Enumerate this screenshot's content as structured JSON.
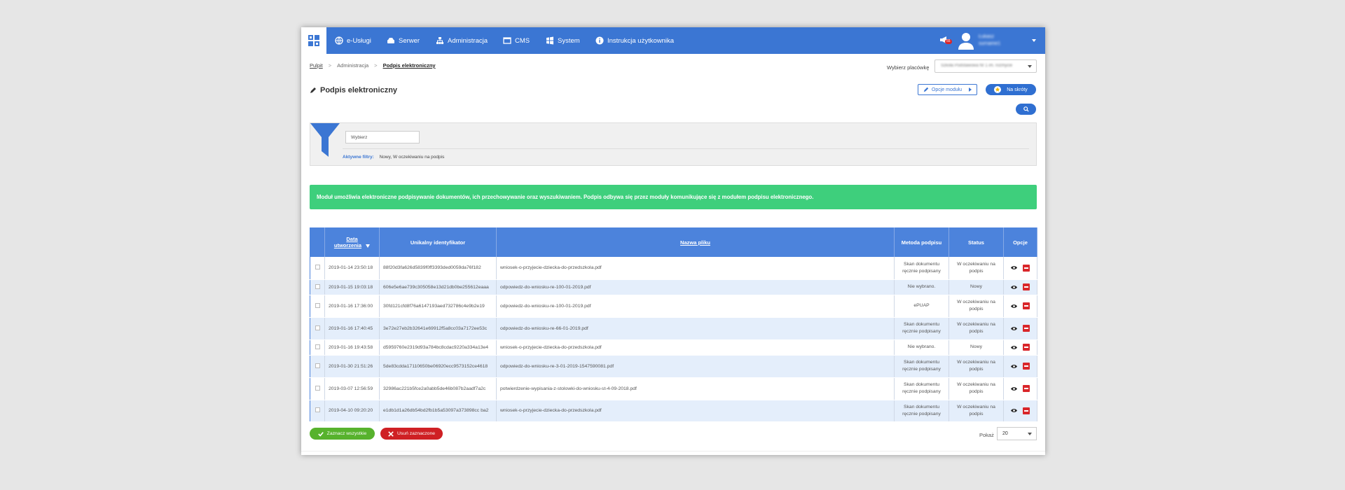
{
  "nav": {
    "items": [
      {
        "label": "e-Usługi",
        "icon": "globe-icon"
      },
      {
        "label": "Serwer",
        "icon": "server-icon"
      },
      {
        "label": "Administracja",
        "icon": "sitemap-icon"
      },
      {
        "label": "CMS",
        "icon": "cms-icon"
      },
      {
        "label": "System",
        "icon": "windows-icon"
      },
      {
        "label": "Instrukcja użytkownika",
        "icon": "info-icon"
      }
    ],
    "notification_badge": "55",
    "user_name_line1": "Łukasz",
    "user_name_line2": "surname1"
  },
  "breadcrumb": {
    "items": [
      "Pulpit",
      "Administracja",
      "Podpis elektroniczny"
    ]
  },
  "placowka": {
    "label": "Wybierz placówkę",
    "value": "Szkoła Podstawowa Nr 1 im. rozmycie"
  },
  "page": {
    "title": "Podpis elektroniczny",
    "options_button": "Opcje modułu",
    "shortcut_button": "Na skróty"
  },
  "filter": {
    "placeholder": "Wybierz",
    "active_label": "Aktywne filtry:",
    "active_value": "Nowy, W oczekiwaniu na podpis"
  },
  "alert": {
    "text": "Moduł umożliwia elektroniczne podpisywanie dokumentów, ich przechowywanie oraz wyszukiwaniem. Podpis odbywa się przez moduły komunikujące się z modułem podpisu elektronicznego."
  },
  "table": {
    "headers": {
      "date_line1": "Data",
      "date_line2": "utworzenia",
      "uid": "Unikalny identyfikator",
      "filename": "Nazwa pliku",
      "method": "Metoda podpisu",
      "status": "Status",
      "options": "Opcje"
    },
    "rows": [
      {
        "date": "2019-01-14 23:50:18",
        "uid": "88f20d3fa626d5839f0ff3393ded0059da76f182",
        "file": "wniosek-o-przyjecie-dziecka-do-przedszkola.pdf",
        "method1": "Skan dokumentu",
        "method2": "ręcznie podpisany",
        "status1": "W oczekiwaniu na",
        "status2": "podpis"
      },
      {
        "date": "2019-01-15 19:03:18",
        "uid": "606e5e6ae739c305058e13d21db0be255612eaaa",
        "file": "odpowiedz-do-wniosku-re-100-01-2019.pdf",
        "method1": "Nie wybrano.",
        "method2": "",
        "status1": "Nowy",
        "status2": ""
      },
      {
        "date": "2019-01-16 17:36:00",
        "uid": "30fd121cfd8f76a6147193aed732786c4e9b2e19",
        "file": "odpowiedz-do-wniosku-re-100-01-2019.pdf",
        "method1": "ePUAP",
        "method2": "",
        "status1": "W oczekiwaniu na",
        "status2": "podpis"
      },
      {
        "date": "2019-01-16 17:40:45",
        "uid": "3e72e27eb2b32641e69912f5a8cc03a7172ee53c",
        "file": "odpowiedz-do-wniosku-re-66-01-2019.pdf",
        "method1": "Skan dokumentu",
        "method2": "ręcznie podpisany",
        "status1": "W oczekiwaniu na",
        "status2": "podpis"
      },
      {
        "date": "2019-01-16 19:43:58",
        "uid": "d5959760e2319d93a784bc8cdac9220a334a13e4",
        "file": "wniosek-o-przyjecie-dziecka-do-przedszkola.pdf",
        "method1": "Nie wybrano.",
        "method2": "",
        "status1": "Nowy",
        "status2": ""
      },
      {
        "date": "2019-01-30 21:51:26",
        "uid": "5de83cdda17110650be06920ecc9573152ce4618",
        "file": "odpowiedz-do-wniosku-re-3-01-2019-1547590081.pdf",
        "method1": "Skan dokumentu",
        "method2": "ręcznie podpisany",
        "status1": "W oczekiwaniu na",
        "status2": "podpis"
      },
      {
        "date": "2019-03-07 12:56:59",
        "uid": "32986ac221b5fce2a0abb5de46b087b2aadf7a2c",
        "file": "potwierdzenie-wypisania-z-stolowki-do-wniosku-st-4-09-2018.pdf",
        "method1": "Skan dokumentu",
        "method2": "ręcznie podpisany",
        "status1": "W oczekiwaniu na",
        "status2": "podpis"
      },
      {
        "date": "2019-04-10 09:20:20",
        "uid": "e1db1d1a26db54bd2fb1b5a53097a373898cc ba2",
        "file": "wniosek-o-przyjecie-dziecka-do-przedszkola.pdf",
        "method1": "Skan dokumentu",
        "method2": "ręcznie podpisany",
        "status1": "W oczekiwaniu na",
        "status2": "podpis"
      }
    ]
  },
  "footer": {
    "select_all": "Zaznacz wszystkie",
    "delete_selected": "Usuń zaznaczone",
    "show_label": "Pokaż",
    "show_value": "20"
  }
}
